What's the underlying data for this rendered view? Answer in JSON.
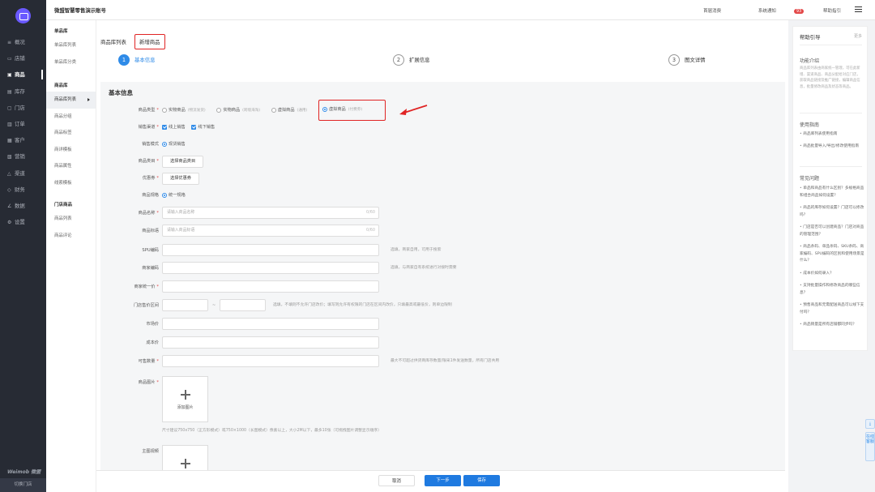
{
  "sidebar": {
    "items": [
      {
        "label": "概况",
        "icon": "≡"
      },
      {
        "label": "店铺",
        "icon": "▭"
      },
      {
        "label": "商品",
        "icon": "▣"
      },
      {
        "label": "库存",
        "icon": "▤"
      },
      {
        "label": "门店",
        "icon": "▢"
      },
      {
        "label": "订单",
        "icon": "▥"
      },
      {
        "label": "客户",
        "icon": "▦"
      },
      {
        "label": "营销",
        "icon": "▧"
      },
      {
        "label": "渠道",
        "icon": "△"
      },
      {
        "label": "财务",
        "icon": "◇"
      },
      {
        "label": "数据",
        "icon": "∠"
      },
      {
        "label": "设置",
        "icon": "⚙"
      }
    ],
    "brand": "Weimob 微盟",
    "switch_store": "切换门店"
  },
  "topbar": {
    "account": "微盟智慧零售演示账号",
    "links": {
      "home": "首届消费",
      "notify": "系统通知",
      "notify_count": "93",
      "guide": "帮助指引"
    }
  },
  "subnav": {
    "groups": [
      {
        "title": "单品库",
        "items": [
          "单品库列表",
          "单品库分类"
        ]
      },
      {
        "title": "商品库",
        "items": [
          "商品库列表",
          "商品分组",
          "商品标签",
          "商详模板",
          "商品属性",
          "线索模板"
        ]
      },
      {
        "title": "门店商品",
        "items": [
          "商品列表",
          "商品评论"
        ]
      }
    ]
  },
  "breadcrumb": {
    "parent": "商品库列表",
    "current": "新增商品"
  },
  "steps": [
    {
      "num": "1",
      "label": "基本信息"
    },
    {
      "num": "2",
      "label": "扩展信息"
    },
    {
      "num": "3",
      "label": "图文详情"
    }
  ],
  "form": {
    "section_title": "基本信息",
    "type": {
      "label": "商品类型",
      "options": [
        {
          "name": "实物商品",
          "note": "(物流发货)"
        },
        {
          "name": "实物商品",
          "note": "(跨境海淘)"
        },
        {
          "name": "虚拟商品",
          "note": "(通用)"
        },
        {
          "name": "虚拟商品",
          "note": "(付费券)"
        }
      ]
    },
    "channel": {
      "label": "销售渠道",
      "opt1": "线上销售",
      "opt2": "线下销售"
    },
    "mode": {
      "label": "销售模式",
      "opt1": "现货销售"
    },
    "category": {
      "label": "商品类目",
      "button": "选择商品类目"
    },
    "coupon": {
      "label": "优惠券",
      "button": "选择优惠券"
    },
    "spec": {
      "label": "商品规格",
      "opt1": "统一规格"
    },
    "name": {
      "label": "商品名称",
      "placeholder": "请输入商品名称",
      "counter": "0/60"
    },
    "subtitle": {
      "label": "商品标语",
      "placeholder": "请输入商品标语",
      "counter": "0/60"
    },
    "spu": {
      "label": "SPU编码",
      "hint": "选填，商家自用，可用于搜索"
    },
    "merchant_code": {
      "label": "商家编码",
      "hint": "选填，与商家自有系统进行对接时需要"
    },
    "price": {
      "label": "商家统一价"
    },
    "store_range": {
      "label": "门店售价区间",
      "hint": "选填，不填则不允许门店改价；填写则允许有权限的门店在区间内改价，只填最高或最低价，则单边限制"
    },
    "market_price": {
      "label": "市场价"
    },
    "cost_price": {
      "label": "成本价"
    },
    "stock": {
      "label": "可售数量",
      "hint": "最大不可超过供货商库存数量/限采1件发送数量，所有门店共用"
    },
    "image": {
      "label": "商品图片",
      "upload": "添加图片",
      "hint": "尺寸建议750x750（正方形模式）或750×1000（长图模式）像素以上，大小2M以下，最多10张（可拖拽图片调整显示顺序）"
    },
    "video": {
      "label": "主图视频"
    }
  },
  "footer": {
    "cancel": "取消",
    "next": "下一步",
    "save": "保存"
  },
  "help": {
    "title": "帮助引导",
    "more": "更多",
    "intro_title": "功能介绍",
    "intro_text": "商品库列表由商家统一管理，可在此新增、渠道商品、商品分配给对应门店，获取商品链接及推广链接，编辑商品信息，批量修改商品及状态等商品。",
    "guide_title": "使用指南",
    "guide_items": [
      "商品库列表使用指南",
      "商品批量导入/导出/修改使用指南"
    ],
    "faq_title": "常见问题",
    "faq_items": [
      "单品和商品有什么区别？多规格商品和组合商品如何设置？",
      "商品的库存如何设置？门店可以修改吗？",
      "门店是否可以创建商品？门店对商品的管理范围？",
      "商品条码、单品条码、SKU条码、商家编码、SPU编码的区别和使用场景是什么？",
      "成本价如何录入？",
      "支持批量操作和修改商品的哪些信息？",
      "预售商品和无需配送商品可以线下支付吗？",
      "商品销量是所有店铺都同步吗？"
    ]
  },
  "float": {
    "tab1": "在线客服"
  },
  "colors": {
    "primary": "#1f7ae0",
    "highlight": "#e02424",
    "sidebar": "#272b34"
  }
}
